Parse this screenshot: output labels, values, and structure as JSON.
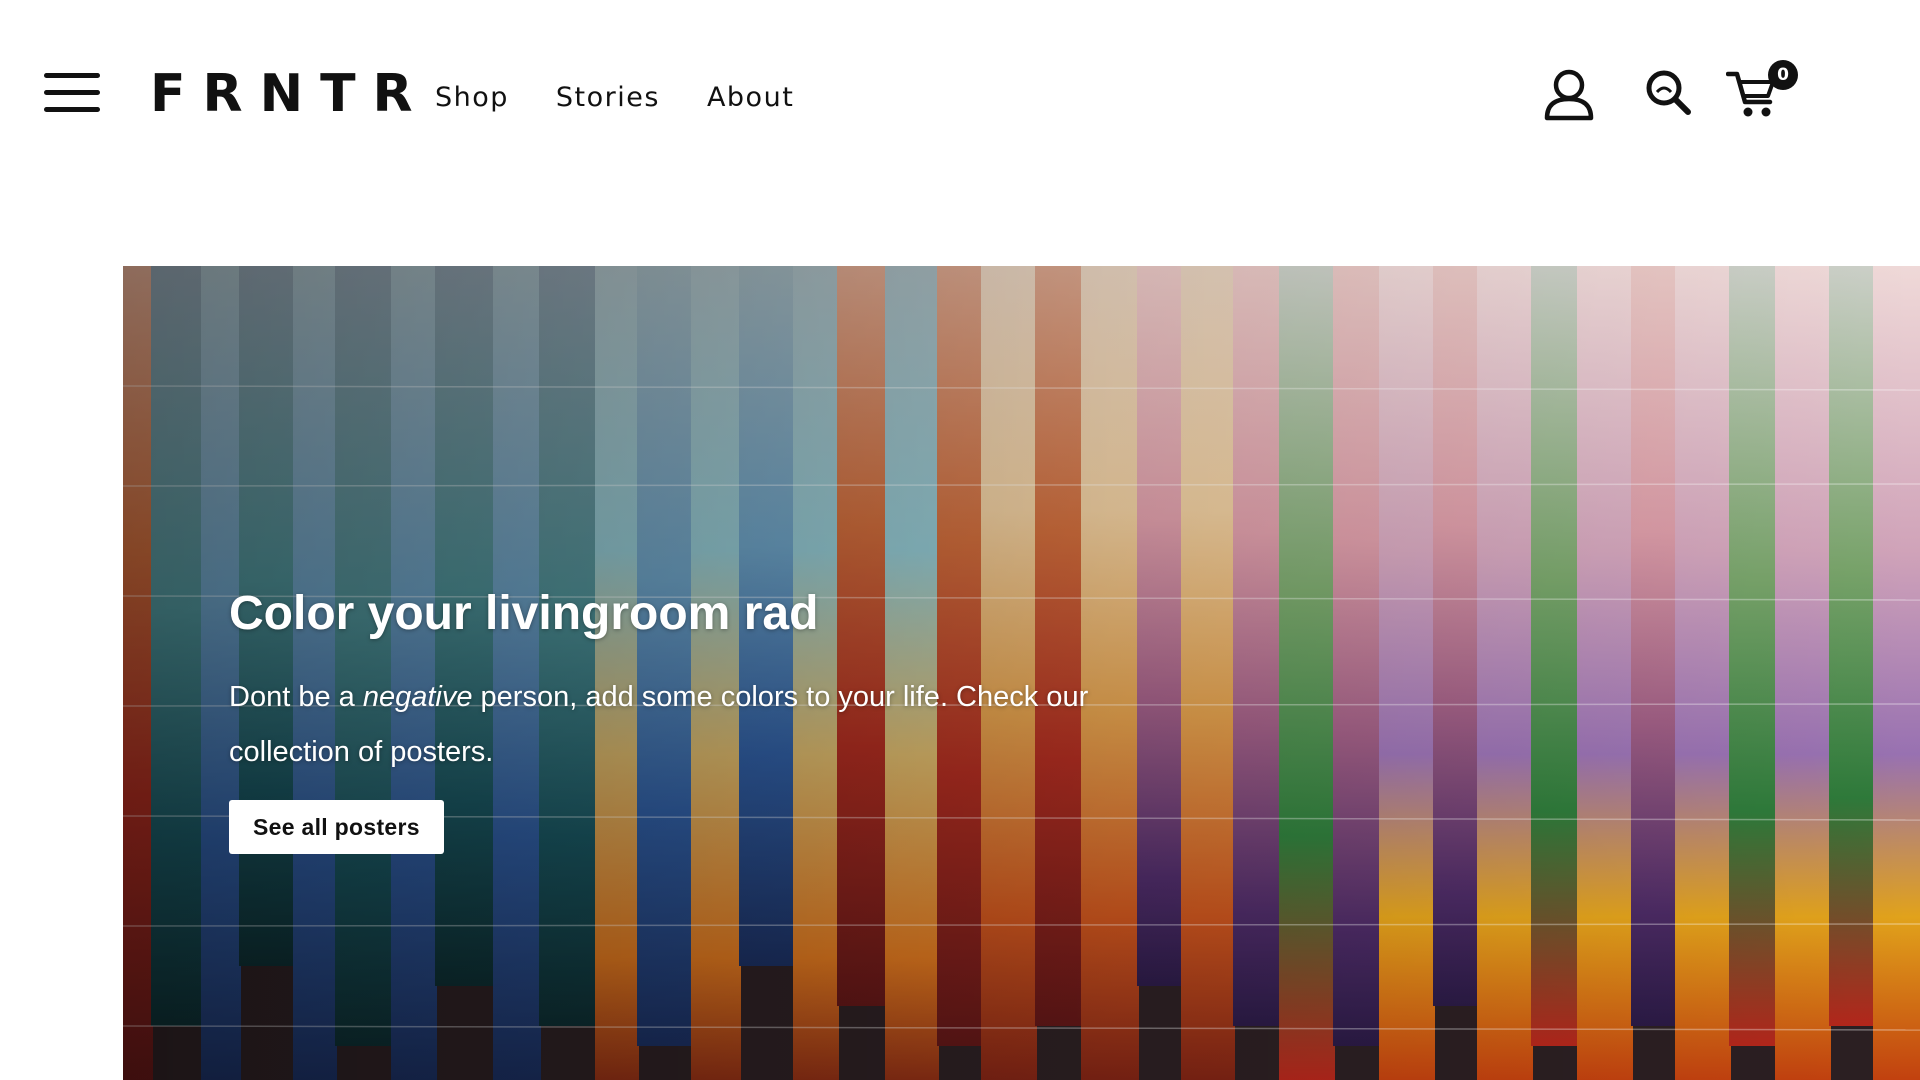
{
  "brand": {
    "logo": "FRNTR"
  },
  "nav": {
    "items": [
      {
        "label": "Shop"
      },
      {
        "label": "Stories"
      },
      {
        "label": "About"
      }
    ]
  },
  "header_icons": {
    "menu": "hamburger-menu-icon",
    "account": "user-account-icon",
    "search": "search-icon",
    "cart": "shopping-cart-icon",
    "cart_count": "0"
  },
  "hero": {
    "title": "Color your livingroom rad",
    "desc_before": "Dont be a ",
    "desc_emphasis": "negative",
    "desc_after": " person, add some colors to your life. Check our collection of posters.",
    "cta_label": "See all posters"
  },
  "colors": {
    "text": "#111111",
    "background": "#ffffff",
    "cta_background": "#ffffff"
  }
}
